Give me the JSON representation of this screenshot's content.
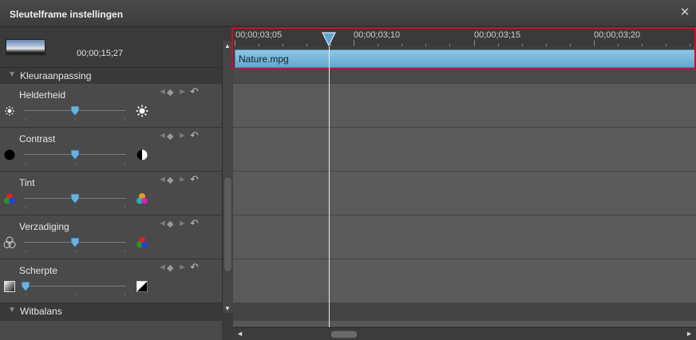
{
  "window": {
    "title": "Sleutelframe instellingen",
    "close_icon": "close-icon"
  },
  "clip_info": {
    "thumbnail_icon": "video-thumbnail",
    "duration": "00;00;15;27"
  },
  "sections": [
    {
      "label": "Kleuraanpassing",
      "expanded": true
    },
    {
      "label": "Witbalans",
      "expanded": false
    }
  ],
  "properties": [
    {
      "label": "Helderheid",
      "icon_left": "sun-small-icon",
      "icon_right": "sun-large-icon",
      "slider_value": 0.5
    },
    {
      "label": "Contrast",
      "icon_left": "black-circle-icon",
      "icon_right": "half-circle-icon",
      "slider_value": 0.5
    },
    {
      "label": "Tint",
      "icon_left": "rgb-circles-icon",
      "icon_right": "rgb-circles-icon",
      "slider_value": 0.5
    },
    {
      "label": "Verzadiging",
      "icon_left": "empty-circles-icon",
      "icon_right": "rgb-circles-icon",
      "slider_value": 0.5
    },
    {
      "label": "Scherpte",
      "icon_left": "gradient-square-icon",
      "icon_right": "sharp-square-icon",
      "slider_value": 0.0
    }
  ],
  "keyframe_controls": {
    "prev_icon": "prev-keyframe-icon",
    "add_icon": "add-keyframe-icon",
    "next_icon": "next-keyframe-icon",
    "reset_icon": "reset-icon"
  },
  "timeline": {
    "timecodes": [
      "00;00;03;05",
      "00;00;03;10",
      "00;00;03;15",
      "00;00;03;20"
    ],
    "clip_name": "Nature.mpg",
    "clip_color": "#7bbbe0",
    "highlight_color": "#c8102e",
    "playhead_icon": "playhead-marker-icon"
  },
  "scrollbars": {
    "vertical_up": "▲",
    "vertical_down": "▼",
    "horizontal_left": "◄",
    "horizontal_right": "►"
  }
}
